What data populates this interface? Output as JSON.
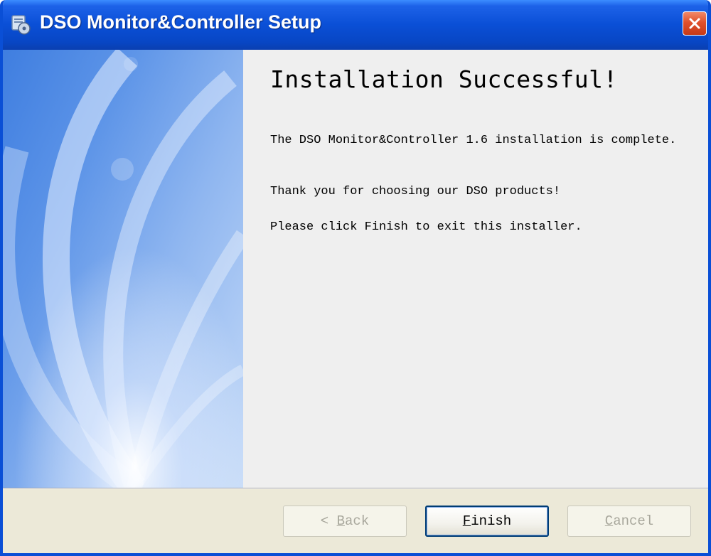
{
  "window": {
    "title": "DSO Monitor&Controller Setup",
    "icon": "installer-icon",
    "colors": {
      "titlebar": "#0a4fd6",
      "close_button": "#e0502c",
      "content_background": "#efefef",
      "footer_background": "#ece9d8"
    }
  },
  "content": {
    "heading": "Installation Successful!",
    "paragraphs": [
      "The DSO Monitor&Controller 1.6 installation is complete.",
      "Thank you for choosing our DSO products!",
      "Please click Finish to exit this installer."
    ]
  },
  "buttons": {
    "back": {
      "mnemonic": "B",
      "rest": "ack",
      "label": "< Back",
      "enabled": false
    },
    "finish": {
      "mnemonic": "F",
      "rest": "inish",
      "label": "Finish",
      "enabled": true,
      "default": true
    },
    "cancel": {
      "mnemonic": "C",
      "rest": "ancel",
      "label": "Cancel",
      "enabled": false
    }
  }
}
